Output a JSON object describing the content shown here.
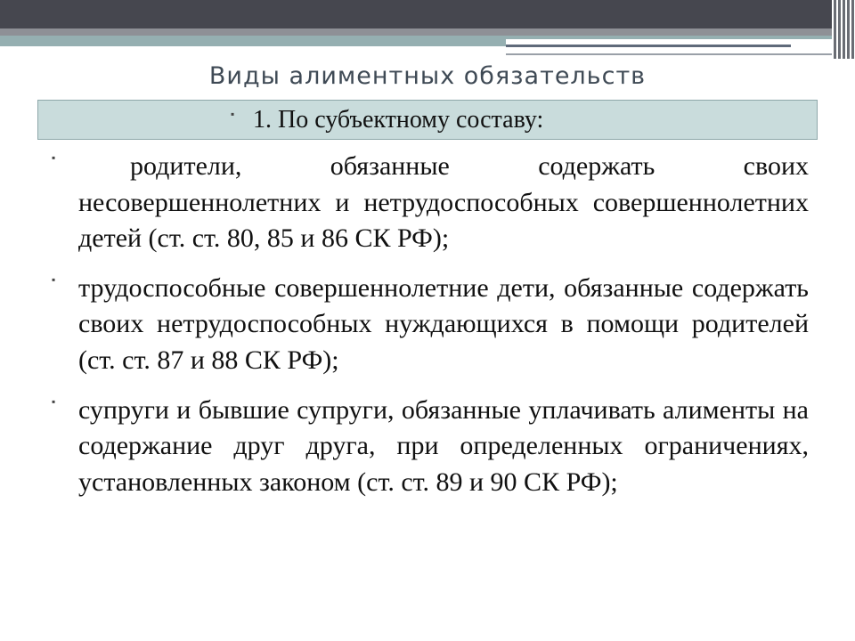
{
  "slide": {
    "title": "Виды алиментных обязательств",
    "subheading": "1. По субъектному составу:",
    "bullet_glyph": "▪",
    "items": [
      {
        "text": "родители, обязанные содержать своих несовершеннолетних и нетрудоспособных совершеннолетних детей (ст. ст. 80, 85 и 86 СК РФ);"
      },
      {
        "text": "трудоспособные совершеннолетние дети, обязанные содержать своих нетрудоспособных нуждающихся в помощи родителей (ст. ст. 87 и 88 СК РФ);"
      },
      {
        "text": "супруги и бывшие супруги, обязанные уплачивать алименты на содержание друг друга, при определенных ограничениях, установленных законом (ст. ст. 89 и 90 СК РФ);"
      }
    ]
  },
  "colors": {
    "header_dark": "#46474f",
    "header_grey": "#8e9096",
    "accent_teal": "#95afb1",
    "subheading_fill": "#c9dcdc",
    "title_text": "#3f4a55",
    "body_text": "#111111"
  }
}
